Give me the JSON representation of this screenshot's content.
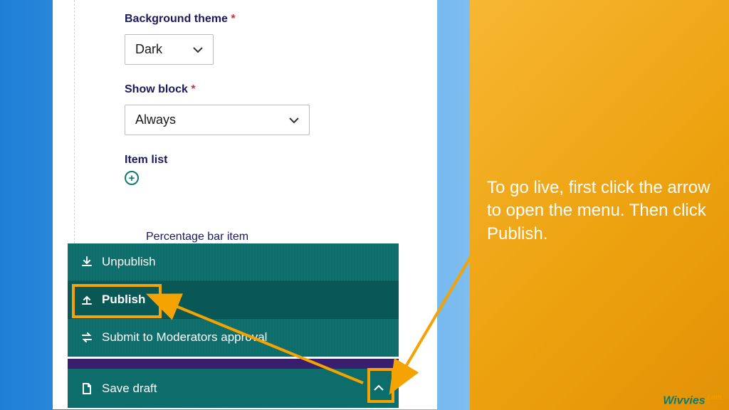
{
  "form": {
    "bg_label": "Background theme",
    "bg_value": "Dark",
    "show_label": "Show block",
    "show_value": "Always",
    "item_list_label": "Item list",
    "peek_item": "Percentage bar item"
  },
  "menu": {
    "unpublish": "Unpublish",
    "publish": "Publish",
    "submit": "Submit to Moderators approval",
    "save": "Save draft"
  },
  "instruction": "To go live, first click the arrow to open the menu. Then click Publish.",
  "brand": "Wivvies"
}
